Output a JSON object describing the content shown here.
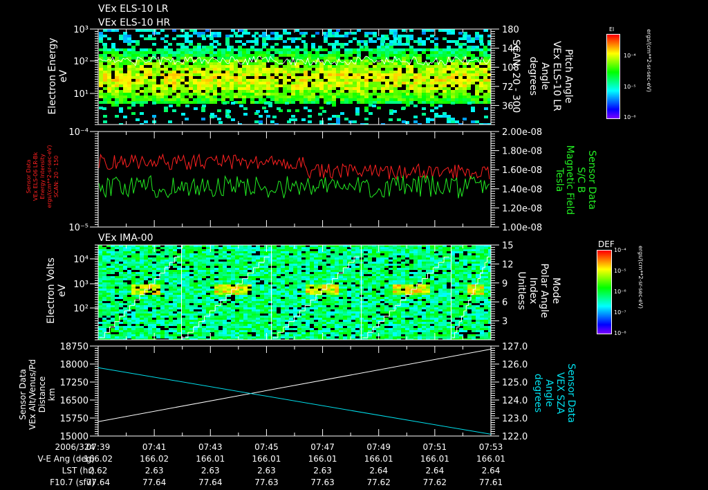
{
  "titles": {
    "els_lr": "VEx ELS-10 LR",
    "els_hr": "VEx ELS-10 HR",
    "ima": "VEx IMA-00"
  },
  "colors": {
    "background": "#000000",
    "axis": "#ffffff",
    "red_series": "#ff2020",
    "green_series": "#22ee22",
    "cyan_series": "#00e0ee"
  },
  "chart_data": [
    {
      "type": "heatmap",
      "title": "VEx ELS-10 LR",
      "ylabel": [
        "Electron Energy",
        "eV"
      ],
      "yscale": "log",
      "ylim": [
        1,
        1000
      ],
      "yticks": [
        "10³",
        "10²",
        "10¹"
      ],
      "y2label": [
        "Pitch Angle",
        "VEx ELS-10 LR",
        "Angle",
        "degrees",
        "SCAN: 20 - 300"
      ],
      "y2lim": [
        0,
        180
      ],
      "y2ticks": [
        "180",
        "144",
        "108",
        "72",
        "36"
      ],
      "overlay_line": {
        "color": "#ffffff",
        "description_value_eV": 100
      },
      "colorbar": {
        "label": "El",
        "ticks": [
          "10⁻⁴",
          "10⁻⁵",
          "10⁻⁶"
        ],
        "units": "ergs/(cm**2-sr-sec-eV)"
      },
      "peak_energy_eV": 30,
      "scan_count": 24
    },
    {
      "type": "line",
      "ylabel": [
        "Sensor Data",
        "VEx ELS-06 LR-Bk",
        "Energy Intensity",
        "ergs/(cm**2-sr-sec-eV)",
        "SCAN: 20 - 150"
      ],
      "yscale": "log",
      "ylim": [
        1e-05,
        0.0001
      ],
      "yticks": [
        "10⁻⁴",
        "10⁻⁵"
      ],
      "y2label": [
        "Sensor Data",
        "S/C B",
        "Magnetic Field",
        "Tesla"
      ],
      "y2lim": [
        1e-08,
        2e-08
      ],
      "y2ticks": [
        "2.00e-08",
        "1.80e-08",
        "1.60e-08",
        "1.40e-08",
        "1.20e-08",
        "1.00e-08"
      ],
      "series": [
        {
          "name": "ELS-06 LR-Bk energy intensity",
          "color": "#ff2020",
          "mean_on_y2": 1.63e-08,
          "spread": 8e-10
        },
        {
          "name": "S/C B magnetic field",
          "color": "#22ee22",
          "mean_on_y2": 1.42e-08,
          "spread": 1.2e-09
        }
      ]
    },
    {
      "type": "heatmap",
      "title": "VEx IMA-00",
      "ylabel": [
        "Electron Volts",
        "eV"
      ],
      "yscale": "log",
      "ylim": [
        5,
        36000
      ],
      "yticks": [
        "10⁴",
        "10³",
        "10²"
      ],
      "y2label": [
        "Mode",
        "Polar Angle",
        "Index",
        "Unitless"
      ],
      "y2lim": [
        0,
        15
      ],
      "y2ticks": [
        "15",
        "12",
        "9",
        "6",
        "3"
      ],
      "sweep_boundaries": [
        "07:42:00",
        "07:45:12",
        "07:48:24",
        "07:51:36"
      ],
      "peak_energy_eV": 600,
      "colorbar": {
        "label": "DEF",
        "ticks": [
          "10⁻⁴",
          "10⁻⁵",
          "10⁻⁶",
          "10⁻⁷",
          "10⁻⁸"
        ],
        "units": "ergs/(cm**2-sr-sec-eV)"
      }
    },
    {
      "type": "line",
      "ylabel": [
        "Sensor Data",
        "VEx Alt/Venus/Pd",
        "Distance",
        "km"
      ],
      "ylim": [
        15000,
        18750
      ],
      "yticks": [
        "18750",
        "18000",
        "17250",
        "16500",
        "15750",
        "15000"
      ],
      "y2label": [
        "Sensor Data",
        "VEX SZA",
        "Angle",
        "degrees"
      ],
      "y2lim": [
        122.0,
        127.0
      ],
      "y2ticks": [
        "127.0",
        "126.0",
        "125.0",
        "124.0",
        "123.0",
        "122.0"
      ],
      "series": [
        {
          "name": "VEx Alt/Venus/Pd Distance (km)",
          "color": "#ffffff",
          "x": [
            "07:39",
            "07:53"
          ],
          "y": [
            15600,
            18620
          ]
        },
        {
          "name": "VEX SZA Angle (degrees)",
          "color": "#00e0ee",
          "x": [
            "07:39",
            "07:53"
          ],
          "y": [
            125.8,
            122.1
          ]
        }
      ]
    }
  ],
  "xaxis": {
    "times": [
      "07:39",
      "07:41",
      "07:43",
      "07:45",
      "07:47",
      "07:49",
      "07:51",
      "07:53"
    ],
    "rows": [
      {
        "label": "2006/324",
        "values": [
          "07:39",
          "07:41",
          "07:43",
          "07:45",
          "07:47",
          "07:49",
          "07:51",
          "07:53"
        ]
      },
      {
        "label": "V-E Ang (deg)",
        "values": [
          "166.02",
          "166.02",
          "166.01",
          "166.01",
          "166.01",
          "166.01",
          "166.01",
          "166.01"
        ]
      },
      {
        "label": "LST (hr)",
        "values": [
          "2.62",
          "2.63",
          "2.63",
          "2.63",
          "2.63",
          "2.64",
          "2.64",
          "2.64"
        ]
      },
      {
        "label": "F10.7 (sfu)",
        "values": [
          "77.64",
          "77.64",
          "77.64",
          "77.63",
          "77.63",
          "77.62",
          "77.62",
          "77.61"
        ]
      }
    ]
  }
}
